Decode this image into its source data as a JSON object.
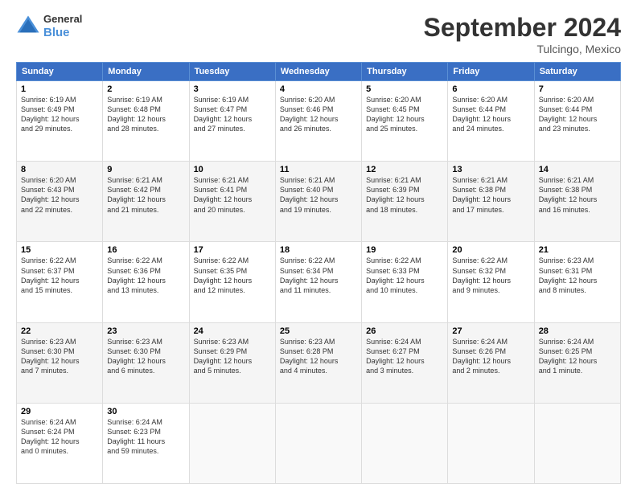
{
  "header": {
    "logo": {
      "line1": "General",
      "line2": "Blue"
    },
    "title": "September 2024",
    "location": "Tulcingo, Mexico"
  },
  "weekdays": [
    "Sunday",
    "Monday",
    "Tuesday",
    "Wednesday",
    "Thursday",
    "Friday",
    "Saturday"
  ],
  "weeks": [
    [
      {
        "day": "1",
        "info": "Sunrise: 6:19 AM\nSunset: 6:49 PM\nDaylight: 12 hours\nand 29 minutes."
      },
      {
        "day": "2",
        "info": "Sunrise: 6:19 AM\nSunset: 6:48 PM\nDaylight: 12 hours\nand 28 minutes."
      },
      {
        "day": "3",
        "info": "Sunrise: 6:19 AM\nSunset: 6:47 PM\nDaylight: 12 hours\nand 27 minutes."
      },
      {
        "day": "4",
        "info": "Sunrise: 6:20 AM\nSunset: 6:46 PM\nDaylight: 12 hours\nand 26 minutes."
      },
      {
        "day": "5",
        "info": "Sunrise: 6:20 AM\nSunset: 6:45 PM\nDaylight: 12 hours\nand 25 minutes."
      },
      {
        "day": "6",
        "info": "Sunrise: 6:20 AM\nSunset: 6:44 PM\nDaylight: 12 hours\nand 24 minutes."
      },
      {
        "day": "7",
        "info": "Sunrise: 6:20 AM\nSunset: 6:44 PM\nDaylight: 12 hours\nand 23 minutes."
      }
    ],
    [
      {
        "day": "8",
        "info": "Sunrise: 6:20 AM\nSunset: 6:43 PM\nDaylight: 12 hours\nand 22 minutes."
      },
      {
        "day": "9",
        "info": "Sunrise: 6:21 AM\nSunset: 6:42 PM\nDaylight: 12 hours\nand 21 minutes."
      },
      {
        "day": "10",
        "info": "Sunrise: 6:21 AM\nSunset: 6:41 PM\nDaylight: 12 hours\nand 20 minutes."
      },
      {
        "day": "11",
        "info": "Sunrise: 6:21 AM\nSunset: 6:40 PM\nDaylight: 12 hours\nand 19 minutes."
      },
      {
        "day": "12",
        "info": "Sunrise: 6:21 AM\nSunset: 6:39 PM\nDaylight: 12 hours\nand 18 minutes."
      },
      {
        "day": "13",
        "info": "Sunrise: 6:21 AM\nSunset: 6:38 PM\nDaylight: 12 hours\nand 17 minutes."
      },
      {
        "day": "14",
        "info": "Sunrise: 6:21 AM\nSunset: 6:38 PM\nDaylight: 12 hours\nand 16 minutes."
      }
    ],
    [
      {
        "day": "15",
        "info": "Sunrise: 6:22 AM\nSunset: 6:37 PM\nDaylight: 12 hours\nand 15 minutes."
      },
      {
        "day": "16",
        "info": "Sunrise: 6:22 AM\nSunset: 6:36 PM\nDaylight: 12 hours\nand 13 minutes."
      },
      {
        "day": "17",
        "info": "Sunrise: 6:22 AM\nSunset: 6:35 PM\nDaylight: 12 hours\nand 12 minutes."
      },
      {
        "day": "18",
        "info": "Sunrise: 6:22 AM\nSunset: 6:34 PM\nDaylight: 12 hours\nand 11 minutes."
      },
      {
        "day": "19",
        "info": "Sunrise: 6:22 AM\nSunset: 6:33 PM\nDaylight: 12 hours\nand 10 minutes."
      },
      {
        "day": "20",
        "info": "Sunrise: 6:22 AM\nSunset: 6:32 PM\nDaylight: 12 hours\nand 9 minutes."
      },
      {
        "day": "21",
        "info": "Sunrise: 6:23 AM\nSunset: 6:31 PM\nDaylight: 12 hours\nand 8 minutes."
      }
    ],
    [
      {
        "day": "22",
        "info": "Sunrise: 6:23 AM\nSunset: 6:30 PM\nDaylight: 12 hours\nand 7 minutes."
      },
      {
        "day": "23",
        "info": "Sunrise: 6:23 AM\nSunset: 6:30 PM\nDaylight: 12 hours\nand 6 minutes."
      },
      {
        "day": "24",
        "info": "Sunrise: 6:23 AM\nSunset: 6:29 PM\nDaylight: 12 hours\nand 5 minutes."
      },
      {
        "day": "25",
        "info": "Sunrise: 6:23 AM\nSunset: 6:28 PM\nDaylight: 12 hours\nand 4 minutes."
      },
      {
        "day": "26",
        "info": "Sunrise: 6:24 AM\nSunset: 6:27 PM\nDaylight: 12 hours\nand 3 minutes."
      },
      {
        "day": "27",
        "info": "Sunrise: 6:24 AM\nSunset: 6:26 PM\nDaylight: 12 hours\nand 2 minutes."
      },
      {
        "day": "28",
        "info": "Sunrise: 6:24 AM\nSunset: 6:25 PM\nDaylight: 12 hours\nand 1 minute."
      }
    ],
    [
      {
        "day": "29",
        "info": "Sunrise: 6:24 AM\nSunset: 6:24 PM\nDaylight: 12 hours\nand 0 minutes."
      },
      {
        "day": "30",
        "info": "Sunrise: 6:24 AM\nSunset: 6:23 PM\nDaylight: 11 hours\nand 59 minutes."
      },
      {
        "day": "",
        "info": ""
      },
      {
        "day": "",
        "info": ""
      },
      {
        "day": "",
        "info": ""
      },
      {
        "day": "",
        "info": ""
      },
      {
        "day": "",
        "info": ""
      }
    ]
  ]
}
